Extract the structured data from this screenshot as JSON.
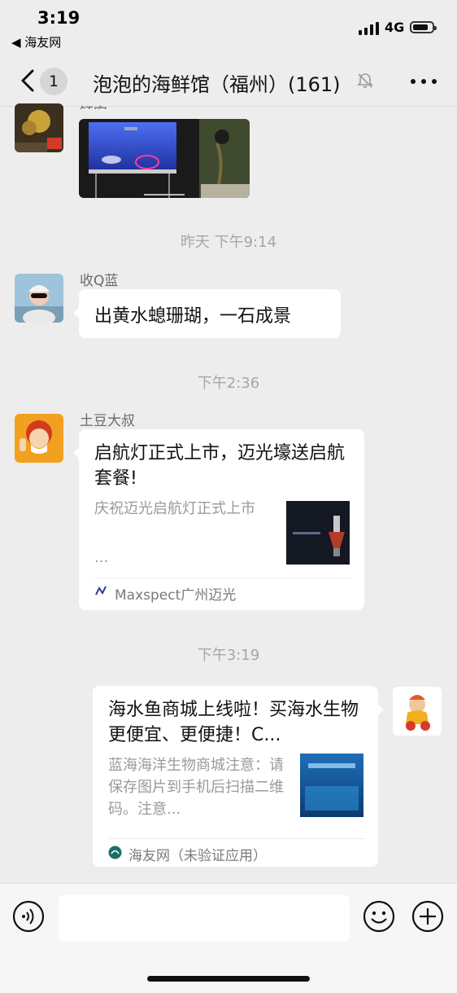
{
  "status": {
    "time": "3:19",
    "back_app": "◀ 海友网",
    "network": "4G"
  },
  "nav": {
    "unread": "1",
    "title": "泡泡的海鲜馆（福州）(161)"
  },
  "messages": {
    "first_sender_partial": "钰宓",
    "ts1": "昨天 下午9:14",
    "m1_sender": "收Q蓝",
    "m1_text": "出黄水螅珊瑚，一石成景",
    "ts2": "下午2:36",
    "m2_sender": "土豆大叔",
    "m2_title": "启航灯正式上市，迈光壕送启航套餐!",
    "m2_desc": "庆祝迈光启航灯正式上市",
    "m2_ellipsis": "...",
    "m2_source": "Maxspect广州迈光",
    "ts3": "下午3:19",
    "m3_title": "海水鱼商城上线啦！买海水生物更便宜、更便捷！C...",
    "m3_desc": "蓝海海洋生物商城注意：请保存图片到手机后扫描二维码。注意...",
    "m3_source": "海友网（未验证应用）"
  },
  "colors": {
    "bubble": "#ffffff",
    "background": "#ededed",
    "meta_text": "#a6a6a6"
  },
  "icons": [
    "back-chevron-icon",
    "mute-bell-icon",
    "more-icon",
    "voice-icon",
    "emoji-icon",
    "plus-icon"
  ]
}
